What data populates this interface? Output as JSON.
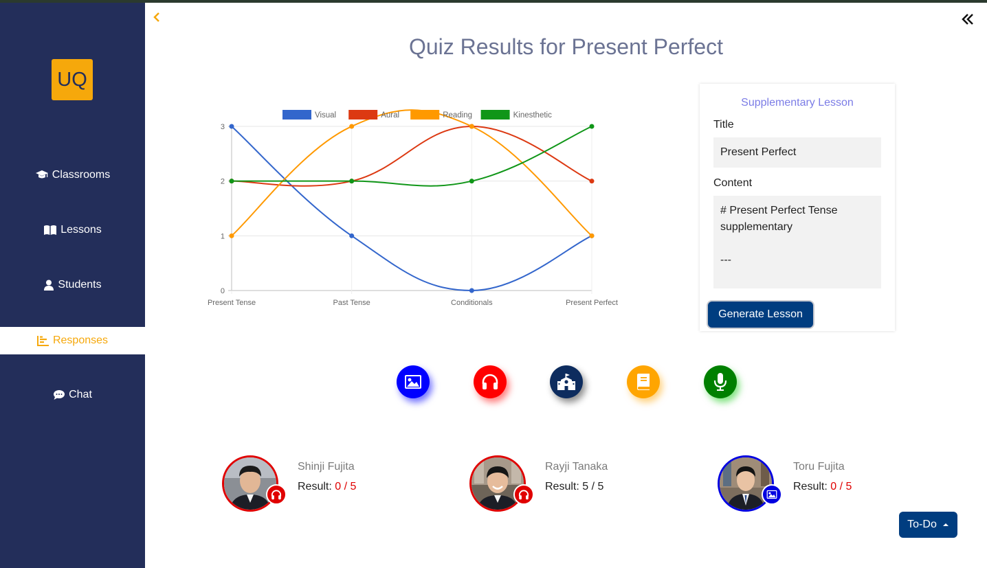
{
  "app": {
    "logo": "UQ"
  },
  "sidebar": {
    "items": [
      {
        "label": "Classrooms",
        "icon": "graduation-cap-icon"
      },
      {
        "label": "Lessons",
        "icon": "book-open-icon"
      },
      {
        "label": "Students",
        "icon": "user-icon"
      },
      {
        "label": "Responses",
        "icon": "bar-chart-icon",
        "active": true
      },
      {
        "label": "Chat",
        "icon": "comment-icon"
      }
    ]
  },
  "page": {
    "title": "Quiz Results for Present Perfect"
  },
  "chart_data": {
    "type": "line",
    "categories": [
      "Present Tense",
      "Past Tense",
      "Conditionals",
      "Present Perfect"
    ],
    "series": [
      {
        "name": "Visual",
        "color": "#3366cc",
        "values": [
          3,
          1,
          0,
          1
        ]
      },
      {
        "name": "Aural",
        "color": "#dc3912",
        "values": [
          2,
          2,
          3,
          2
        ]
      },
      {
        "name": "Reading",
        "color": "#ff9900",
        "values": [
          1,
          3,
          3,
          1
        ]
      },
      {
        "name": "Kinesthetic",
        "color": "#109618",
        "values": [
          2,
          2,
          2,
          3
        ]
      }
    ],
    "ylim": [
      0,
      3
    ],
    "yticks": [
      "0",
      "1",
      "2",
      "3"
    ],
    "legend": "top",
    "grid": true,
    "smooth": true
  },
  "supplementary": {
    "heading": "Supplementary Lesson",
    "title_label": "Title",
    "title_value": "Present Perfect",
    "content_label": "Content",
    "content_value": "# Present Perfect Tense\nsupplementary\n\n---",
    "button": "Generate Lesson"
  },
  "learning_styles": [
    {
      "icon": "image-icon",
      "color": "#0000ff"
    },
    {
      "icon": "headphones-icon",
      "color": "#ff0000"
    },
    {
      "icon": "school-icon",
      "color": "#003366"
    },
    {
      "icon": "book-icon",
      "color": "#ffa500"
    },
    {
      "icon": "microphone-icon",
      "color": "#008000"
    }
  ],
  "students": [
    {
      "name": "Shinji Fujita",
      "result_label": "Result:",
      "score": "0 / 5",
      "score_color": "#e00000",
      "ring": "#e00000",
      "badge_icon": "headphones-icon"
    },
    {
      "name": "Rayji Tanaka",
      "result_label": "Result:",
      "score": "5 / 5",
      "score_color": "#212121",
      "ring": "#e00000",
      "badge_icon": "headphones-icon"
    },
    {
      "name": "Toru Fujita",
      "result_label": "Result:",
      "score": "0 / 5",
      "score_color": "#e00000",
      "ring": "#0000e0",
      "badge_icon": "image-icon"
    }
  ],
  "todo": {
    "label": "To-Do"
  }
}
